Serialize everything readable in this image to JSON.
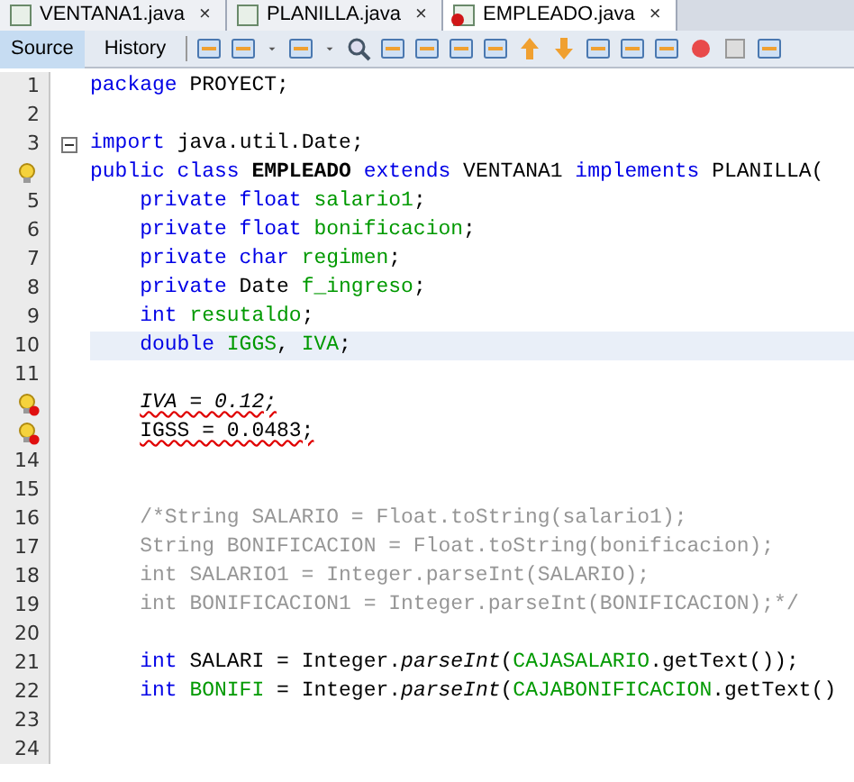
{
  "file_tabs": [
    {
      "label": "VENTANA1.java",
      "close": "×",
      "selected": false,
      "badge": false
    },
    {
      "label": "PLANILLA.java",
      "close": "×",
      "selected": false,
      "badge": false
    },
    {
      "label": "EMPLEADO.java",
      "close": "×",
      "selected": true,
      "badge": true
    }
  ],
  "view_tabs": [
    {
      "label": "Source",
      "selected": true
    },
    {
      "label": "History",
      "selected": false
    }
  ],
  "lines": [
    {
      "number": "1",
      "tokens": [
        {
          "kind": "keyword",
          "text": "package"
        },
        {
          "kind": "plain",
          "text": " PROYECT;"
        }
      ]
    },
    {
      "number": "2"
    },
    {
      "number": "3",
      "fold": true,
      "tokens": [
        {
          "kind": "keyword",
          "text": "import"
        },
        {
          "kind": "plain",
          "text": " java.util.Date;"
        }
      ]
    },
    {
      "hint": true,
      "error": false,
      "tokens": [
        {
          "kind": "keyword",
          "text": "public class "
        },
        {
          "kind": "bold",
          "text": "EMPLEADO"
        },
        {
          "kind": "keyword",
          "text": " extends"
        },
        {
          "kind": "plain",
          "text": " VENTANA1 "
        },
        {
          "kind": "keyword",
          "text": "implements"
        },
        {
          "kind": "plain",
          "text": " PLANILLA("
        }
      ]
    },
    {
      "number": "5",
      "indented": true,
      "tokens": [
        {
          "kind": "keyword",
          "text": "private float "
        },
        {
          "kind": "field",
          "text": "salario1"
        },
        {
          "kind": "plain",
          "text": ";"
        }
      ]
    },
    {
      "number": "6",
      "indented": true,
      "tokens": [
        {
          "kind": "keyword",
          "text": "private float "
        },
        {
          "kind": "field",
          "text": "bonificacion"
        },
        {
          "kind": "plain",
          "text": ";"
        }
      ]
    },
    {
      "number": "7",
      "indented": true,
      "tokens": [
        {
          "kind": "keyword",
          "text": "private char "
        },
        {
          "kind": "field",
          "text": "regimen"
        },
        {
          "kind": "plain",
          "text": ";"
        }
      ]
    },
    {
      "number": "8",
      "indented": true,
      "tokens": [
        {
          "kind": "keyword",
          "text": "private"
        },
        {
          "kind": "plain",
          "text": " Date "
        },
        {
          "kind": "field",
          "text": "f_ingreso"
        },
        {
          "kind": "plain",
          "text": ";"
        }
      ]
    },
    {
      "number": "9",
      "indented": true,
      "tokens": [
        {
          "kind": "keyword",
          "text": "int "
        },
        {
          "kind": "field",
          "text": "resutaldo"
        },
        {
          "kind": "plain",
          "text": ";"
        }
      ]
    },
    {
      "number": "10",
      "indented": true,
      "highlighted": true,
      "tokens": [
        {
          "kind": "keyword",
          "text": "double "
        },
        {
          "kind": "field",
          "text": "IGGS"
        },
        {
          "kind": "plain",
          "text": ", "
        },
        {
          "kind": "field",
          "text": "IVA"
        },
        {
          "kind": "plain",
          "text": ";"
        }
      ]
    },
    {
      "number": "11",
      "highlighted": false
    },
    {
      "hint": true,
      "error": true,
      "indented": true,
      "tokens": [
        {
          "kind": "error-italic",
          "text": "IVA = 0.12;"
        }
      ]
    },
    {
      "hint": true,
      "error": true,
      "indented": true,
      "tokens": [
        {
          "kind": "error",
          "text": "IGSS = 0.0483;"
        }
      ]
    },
    {
      "number": "14"
    },
    {
      "number": "15"
    },
    {
      "number": "16",
      "indented": true,
      "tokens": [
        {
          "kind": "comment",
          "text": "/*String SALARIO = Float.toString(salario1);"
        }
      ]
    },
    {
      "number": "17",
      "indented": true,
      "tokens": [
        {
          "kind": "comment",
          "text": "String BONIFICACION = Float.toString(bonificacion);"
        }
      ]
    },
    {
      "number": "18",
      "indented": true,
      "tokens": [
        {
          "kind": "comment",
          "text": "int SALARIO1 = Integer.parseInt(SALARIO);"
        }
      ]
    },
    {
      "number": "19",
      "indented": true,
      "tokens": [
        {
          "kind": "comment",
          "text": "int BONIFICACION1 = Integer.parseInt(BONIFICACION);*/"
        }
      ]
    },
    {
      "number": "20"
    },
    {
      "number": "21",
      "indented": true,
      "tokens": [
        {
          "kind": "keyword",
          "text": "int"
        },
        {
          "kind": "plain",
          "text": " SALARI = Integer."
        },
        {
          "kind": "italic",
          "text": "parseInt"
        },
        {
          "kind": "plain",
          "text": "("
        },
        {
          "kind": "field",
          "text": "CAJASALARIO"
        },
        {
          "kind": "plain",
          "text": ".getText());"
        }
      ]
    },
    {
      "number": "22",
      "indented": true,
      "tokens": [
        {
          "kind": "keyword",
          "text": "int "
        },
        {
          "kind": "field",
          "text": "BONIFI"
        },
        {
          "kind": "plain",
          "text": " = Integer."
        },
        {
          "kind": "italic",
          "text": "parseInt"
        },
        {
          "kind": "plain",
          "text": "("
        },
        {
          "kind": "field",
          "text": "CAJABONIFICACION"
        },
        {
          "kind": "plain",
          "text": ".getText()"
        }
      ]
    },
    {
      "number": "23"
    },
    {
      "number": "24"
    }
  ]
}
